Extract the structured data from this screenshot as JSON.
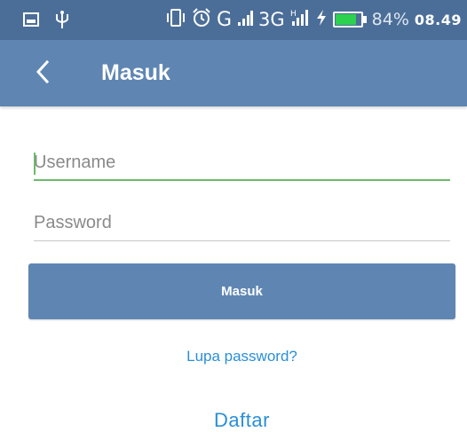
{
  "status_bar": {
    "carrier_label": "G",
    "network_label": "3G",
    "battery_percent_label": "84%",
    "battery_level": 0.84,
    "time": "08.49",
    "icons": [
      "image-icon",
      "usb-icon",
      "vibrate-icon",
      "alarm-icon",
      "signal-icon",
      "signal-h-icon",
      "charging-icon",
      "battery-icon"
    ]
  },
  "toolbar": {
    "title": "Masuk",
    "back_icon": "chevron-left-icon"
  },
  "form": {
    "username_placeholder": "Username",
    "username_value": "",
    "password_placeholder": "Password",
    "password_value": "",
    "submit_label": "Masuk"
  },
  "links": {
    "forgot_password": "Lupa password?",
    "register": "Daftar"
  },
  "colors": {
    "status_bar": "#4b6e98",
    "toolbar": "#5f86b3",
    "button": "#5f86b3",
    "focus_underline": "#6cba6c",
    "link": "#2a8fd6",
    "battery_fill": "#2bd14f"
  }
}
